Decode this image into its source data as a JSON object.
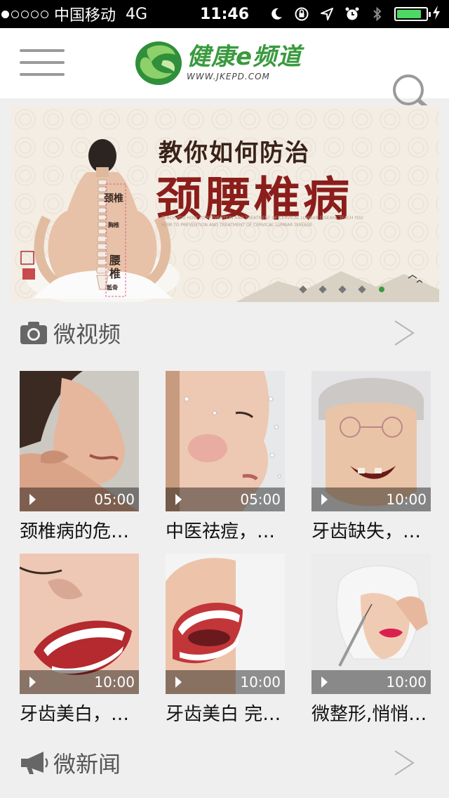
{
  "status": {
    "carrier": "中国移动",
    "network": "4G",
    "time": "11:46",
    "signal_bars_on": 1,
    "signal_bars_total": 5,
    "battery_level": 0.85,
    "battery_color": "#4cd964"
  },
  "nav": {
    "menu_icon": "hamburger-menu-icon",
    "logo_name": "健康e频道",
    "logo_url": "WWW.JKEPD.COM",
    "search_icon": "search-icon",
    "brand_color": "#3a9a3e"
  },
  "banner": {
    "line1": "教你如何防治",
    "line2": "颈腰椎病",
    "subtext": "TEACH YOU HOW TO PREVENTION AND TREATMENT OF CERVICAL LUMBAR DISEASE TEACH YOU HOW TO PREVENTION AND TREATMENT OF CERVICAL LUMBAR DISEASE",
    "label_neck": "颈椎",
    "label_chest": "胸椎",
    "label_waist1": "腰",
    "label_waist2": "椎",
    "label_sacrum": "骶骨",
    "active_page": 5,
    "total_pages": 5
  },
  "sections": {
    "video": {
      "title": "微视频",
      "icon": "camera-icon",
      "arrow": "chevron-right-icon"
    },
    "news": {
      "title": "微新闻",
      "icon": "megaphone-icon",
      "arrow": "chevron-right-icon"
    }
  },
  "videos": [
    {
      "caption": "颈椎病的危…",
      "duration": "05:00"
    },
    {
      "caption": "中医祛痘，…",
      "duration": "05:00"
    },
    {
      "caption": "牙齿缺失，…",
      "duration": "10:00"
    },
    {
      "caption": "牙齿美白，…",
      "duration": "10:00"
    },
    {
      "caption": "牙齿美白 完…",
      "duration": "10:00"
    },
    {
      "caption": "微整形,悄悄…",
      "duration": "10:00"
    }
  ]
}
